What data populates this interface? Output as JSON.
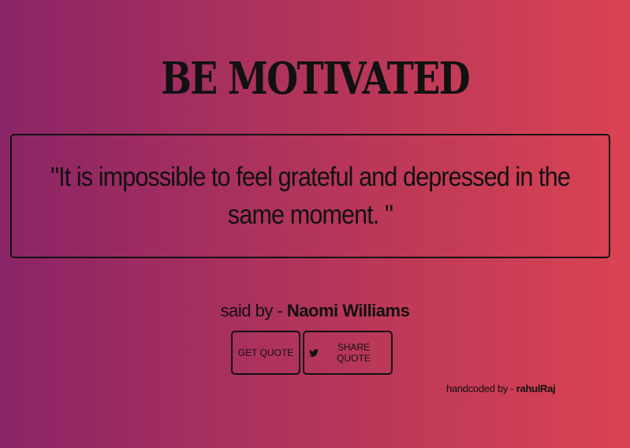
{
  "header": {
    "title": "BE MOTIVATED"
  },
  "quote": {
    "text": "\"It is impossible to feel grateful and depressed in the same moment. \""
  },
  "author": {
    "prefix": "said by - ",
    "name": "Naomi Williams"
  },
  "buttons": {
    "get_quote": "GET QUOTE",
    "share_quote": "SHARE QUOTE",
    "share_icon": "twitter-icon"
  },
  "footer": {
    "prefix": "handcoded by - ",
    "name": "rahulRaj"
  },
  "colors": {
    "gradient_start": "#8a2466",
    "gradient_end": "#da4352",
    "text": "#111111"
  }
}
